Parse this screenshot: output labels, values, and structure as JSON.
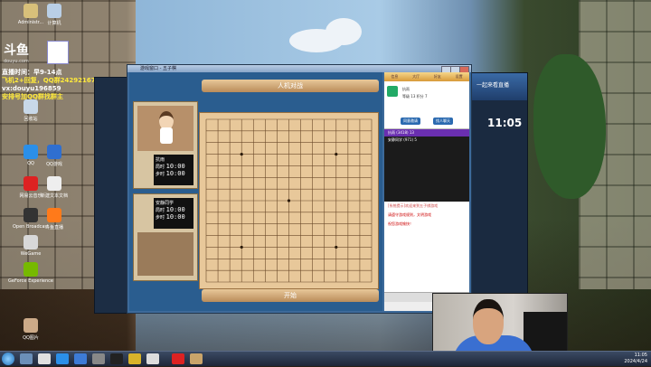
{
  "overlay": {
    "lines": [
      {
        "text": "直播时间：早9-14点",
        "color": "#ffffff"
      },
      {
        "text": "飞机2+回复，QQ群242921671",
        "color": "#ffea3b"
      },
      {
        "text": "vx:douyu196859",
        "color": "#ffffff"
      },
      {
        "text": "安排号加QQ群找群主",
        "color": "#ffea3b"
      }
    ],
    "logo_text": "斗鱼",
    "logo_sub": "douyu.com"
  },
  "desktop_icons": [
    {
      "label": "Administr...",
      "icon": "user-folder-icon",
      "color": "#d8c07a"
    },
    {
      "label": "计算机",
      "icon": "computer-icon",
      "color": "#b9cfe6"
    },
    {
      "label": "回收站",
      "icon": "recycle-bin-icon",
      "color": "#c8d8e8"
    },
    {
      "label": "QQ",
      "icon": "qq-icon",
      "color": "#2b8fe8"
    },
    {
      "label": "QQ游戏",
      "icon": "qq-game-icon",
      "color": "#2f6fd0"
    },
    {
      "label": "WeGame",
      "icon": "wegame-icon",
      "color": "#d8d8d8"
    },
    {
      "label": "GeForce Experience",
      "icon": "geforce-icon",
      "color": "#76b900"
    },
    {
      "label": "网易云音乐",
      "icon": "music-icon",
      "color": "#d22"
    },
    {
      "label": "Open Broadcast",
      "icon": "obs-icon",
      "color": "#333"
    },
    {
      "label": "新建文本文档",
      "icon": "text-file-icon",
      "color": "#eeeeee"
    },
    {
      "label": "斗鱼直播",
      "icon": "douyu-icon",
      "color": "#ff7a1a"
    },
    {
      "label": "QQ图片",
      "icon": "image-file-icon",
      "color": "#ccaa88"
    }
  ],
  "game": {
    "window_title": "游戏窗口 - 五子棋",
    "banner_top": "人机对战",
    "banner_bottom": "开始",
    "player1": {
      "name": "抗雨",
      "label1": "局时",
      "time1": "10:00",
      "label2": "步时",
      "time2": "10:00"
    },
    "player2": {
      "name": "安静同学",
      "label1": "局时",
      "time1": "10:00",
      "label2": "步时",
      "time2": "10:00"
    },
    "board": {
      "size": 15
    }
  },
  "side": {
    "tabs": [
      "信息",
      "大厅",
      "好友",
      "设置"
    ],
    "user": {
      "name": "抗雨",
      "rank_label": "等级",
      "rank_value": "13",
      "score_label": "积分",
      "score_value": "7"
    },
    "buttons": [
      "同意邀请",
      "找人聊天"
    ],
    "list": [
      {
        "name": "抗雨",
        "score": "(3418)",
        "extra": "13",
        "selected": true
      },
      {
        "name": "安静同学",
        "score": "(971)",
        "extra": "5",
        "selected": false
      }
    ],
    "chat": [
      "[系统提示]欢迎来到五子棋游戏",
      "请遵守游戏规则，文明游戏",
      "祝您游戏愉快！"
    ],
    "send_label": "发送"
  },
  "right_window": {
    "title": "一起来看直播",
    "clock": "11:05"
  },
  "taskbar": {
    "time": "11:05",
    "date": "2024/4/24"
  }
}
